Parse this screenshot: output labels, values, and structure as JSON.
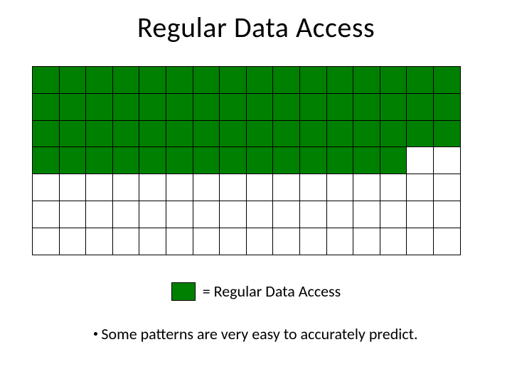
{
  "title": "Regular Data Access",
  "grid": {
    "cols": 16,
    "rows": 7,
    "filled_count": 62
  },
  "legend": {
    "label": "= Regular Data Access",
    "color": "#008000"
  },
  "bullet_text": "Some patterns are very easy to accurately predict.",
  "chart_data": {
    "type": "table",
    "title": "Regular Data Access",
    "description": "A 16×7 grid of cells where the first 62 cells in row-major order are filled green (regular data access) and the remaining cells are white.",
    "rows": 7,
    "cols": 16,
    "cells": [
      [
        1,
        1,
        1,
        1,
        1,
        1,
        1,
        1,
        1,
        1,
        1,
        1,
        1,
        1,
        1,
        1
      ],
      [
        1,
        1,
        1,
        1,
        1,
        1,
        1,
        1,
        1,
        1,
        1,
        1,
        1,
        1,
        1,
        1
      ],
      [
        1,
        1,
        1,
        1,
        1,
        1,
        1,
        1,
        1,
        1,
        1,
        1,
        1,
        1,
        1,
        1
      ],
      [
        1,
        1,
        1,
        1,
        1,
        1,
        1,
        1,
        1,
        1,
        1,
        1,
        1,
        1,
        0,
        0
      ],
      [
        0,
        0,
        0,
        0,
        0,
        0,
        0,
        0,
        0,
        0,
        0,
        0,
        0,
        0,
        0,
        0
      ],
      [
        0,
        0,
        0,
        0,
        0,
        0,
        0,
        0,
        0,
        0,
        0,
        0,
        0,
        0,
        0,
        0
      ],
      [
        0,
        0,
        0,
        0,
        0,
        0,
        0,
        0,
        0,
        0,
        0,
        0,
        0,
        0,
        0,
        0
      ]
    ],
    "legend": {
      "1": "Regular Data Access (green)",
      "0": "Empty (white)"
    }
  }
}
